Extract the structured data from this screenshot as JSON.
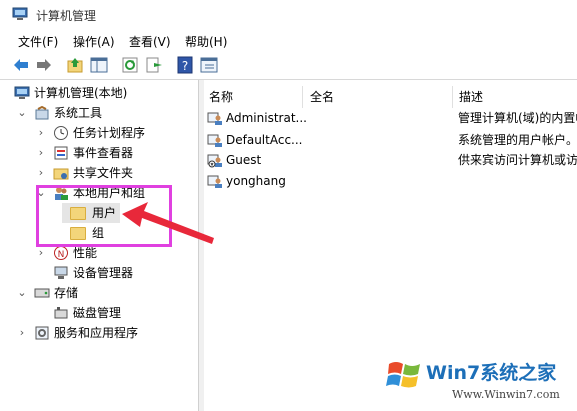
{
  "window": {
    "title": "计算机管理"
  },
  "menu": [
    "文件(F)",
    "操作(A)",
    "查看(V)",
    "帮助(H)"
  ],
  "toolbar": [
    "back-icon",
    "forward-icon",
    "up-folder-icon",
    "show-hide-tree-icon",
    "refresh-icon",
    "export-list-icon",
    "help-icon",
    "properties-icon"
  ],
  "tree": {
    "root": "计算机管理(本地)",
    "system_tools": "系统工具",
    "task_scheduler": "任务计划程序",
    "event_viewer": "事件查看器",
    "shared_folders": "共享文件夹",
    "local_users": "本地用户和组",
    "users": "用户",
    "groups": "组",
    "performance": "性能",
    "device_manager": "设备管理器",
    "storage": "存储",
    "disk_management": "磁盘管理",
    "services": "服务和应用程序"
  },
  "list": {
    "columns": [
      "名称",
      "全名",
      "描述"
    ],
    "rows": [
      {
        "name": "Administrat...",
        "fullname": "",
        "desc": "管理计算机(域)的内置帐户"
      },
      {
        "name": "DefaultAcc...",
        "fullname": "",
        "desc": "系统管理的用户帐户。"
      },
      {
        "name": "Guest",
        "fullname": "",
        "desc": "供来宾访问计算机或访问域的内置帐户"
      },
      {
        "name": "yonghang",
        "fullname": "",
        "desc": ""
      }
    ]
  },
  "watermark": {
    "title": "Win7系统之家",
    "url": "Www.Winwin7.com"
  },
  "colors": {
    "highlight_box": "#e040e0",
    "arrow": "#e8283a",
    "selection": "#e5e5e5"
  }
}
